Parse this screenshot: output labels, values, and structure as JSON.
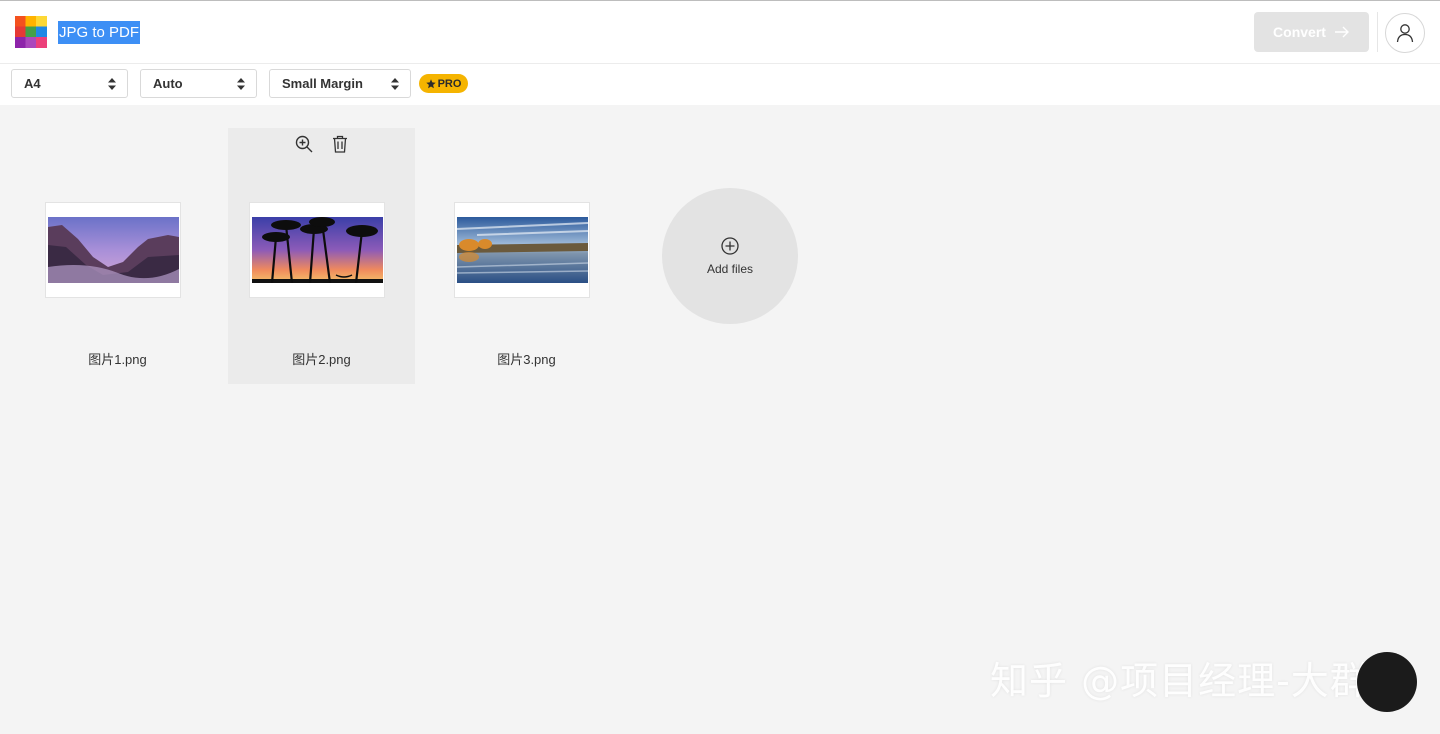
{
  "header": {
    "title": "JPG to PDF",
    "convert_label": "Convert",
    "convert_arrow_icon": "arrow-right-icon",
    "user_icon": "user-icon"
  },
  "toolbar": {
    "page_size": "A4",
    "orientation": "Auto",
    "margin": "Small Margin",
    "pro_label": "PRO"
  },
  "files": [
    {
      "name": "图片1.png"
    },
    {
      "name": "图片2.png"
    },
    {
      "name": "图片3.png"
    }
  ],
  "add_files": {
    "label": "Add files",
    "icon": "plus-circle-icon"
  },
  "watermark": {
    "text": "知乎 @项目经理-大群"
  },
  "colors": {
    "selection_blue": "#3d8ff5",
    "pro_yellow": "#f5b400",
    "disabled_button": "#e3e3e3",
    "background": "#f4f4f4"
  }
}
